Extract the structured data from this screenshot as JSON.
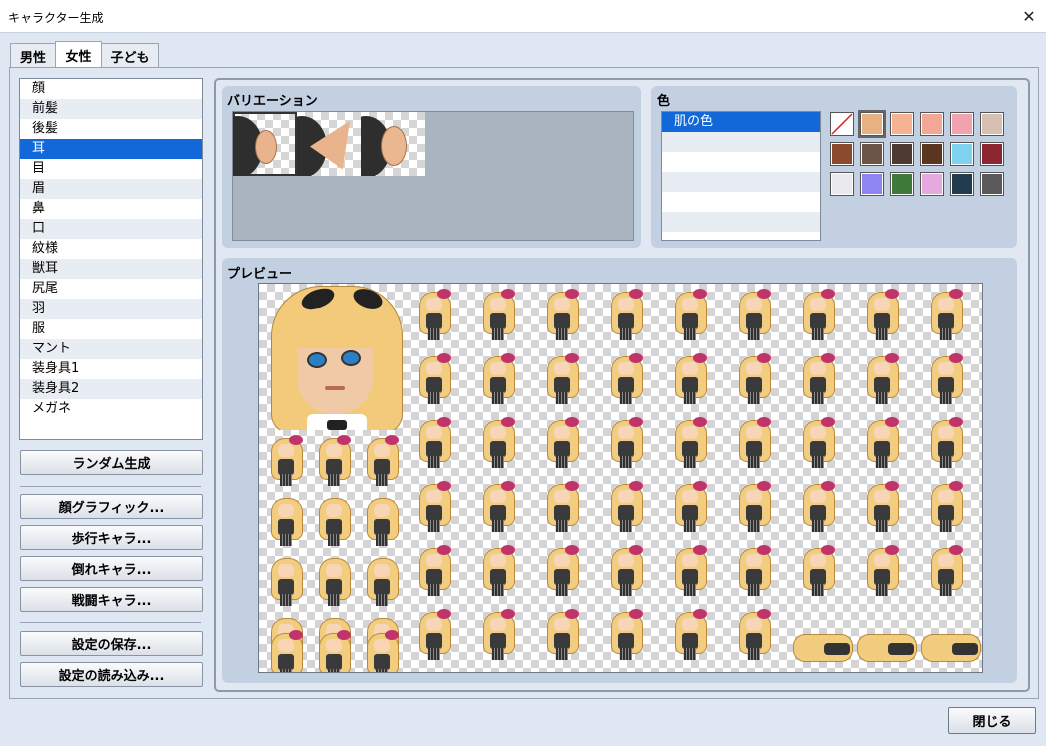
{
  "window": {
    "title": "キャラクター生成",
    "close_icon": "close-icon"
  },
  "tabs": [
    {
      "label": "男性",
      "active": false
    },
    {
      "label": "女性",
      "active": true
    },
    {
      "label": "子ども",
      "active": false
    }
  ],
  "parts": {
    "items": [
      "顔",
      "前髪",
      "後髪",
      "耳",
      "目",
      "眉",
      "鼻",
      "口",
      "紋様",
      "獣耳",
      "尻尾",
      "羽",
      "服",
      "マント",
      "装身具1",
      "装身具2",
      "メガネ"
    ],
    "selected": "耳"
  },
  "buttons": {
    "random": "ランダム生成",
    "face": "顔グラフィック...",
    "walk": "歩行キャラ...",
    "down": "倒れキャラ...",
    "battle": "戦闘キャラ...",
    "save": "設定の保存...",
    "load": "設定の読み込み...",
    "close": "閉じる"
  },
  "variation": {
    "label": "バリエーション",
    "selected_index": 0,
    "count": 3
  },
  "color": {
    "label": "色",
    "rows": [
      "肌の色"
    ],
    "swatches": [
      "none",
      "#e8b184",
      "#f6b393",
      "#f3a896",
      "#f1a2ae",
      "#d7bfb2",
      "#8a4b2d",
      "#6b5448",
      "#4d3b33",
      "#5a3520",
      "#7fd2ef",
      "#8c2630",
      "#e9e9ee",
      "#8d86f0",
      "#3f7a3a",
      "#e6a8e0",
      "#233b4e",
      "#5a5a5a"
    ],
    "selected_swatch": 1
  },
  "preview": {
    "label": "プレビュー"
  }
}
